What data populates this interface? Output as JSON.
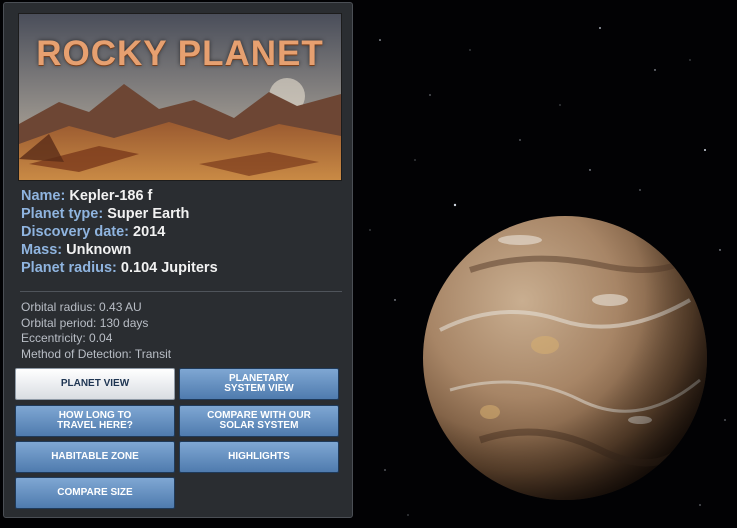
{
  "banner": {
    "title": "ROCKY PLANET"
  },
  "info": [
    {
      "label": "Name:",
      "value": "Kepler-186 f"
    },
    {
      "label": "Planet type:",
      "value": "Super Earth"
    },
    {
      "label": "Discovery date:",
      "value": "2014"
    },
    {
      "label": "Mass:",
      "value": "Unknown"
    },
    {
      "label": "Planet radius:",
      "value": "0.104 Jupiters"
    }
  ],
  "orbital": [
    "Orbital radius: 0.43 AU",
    "Orbital period:  130 days",
    "Eccentricity: 0.04",
    "Method of Detection: Transit"
  ],
  "buttons": {
    "planet_view": "PLANET VIEW",
    "planetary_system_view": "PLANETARY\nSYSTEM VIEW",
    "how_long": "HOW LONG TO\nTRAVEL HERE?",
    "compare_solar": "COMPARE WITH OUR\nSOLAR SYSTEM",
    "habitable_zone": "HABITABLE ZONE",
    "highlights": "HIGHLIGHTS",
    "compare_size": "COMPARE SIZE"
  },
  "colors": {
    "accent_label": "#8fb4df",
    "button": "#5f89bd",
    "panel": "#2a2d31"
  }
}
